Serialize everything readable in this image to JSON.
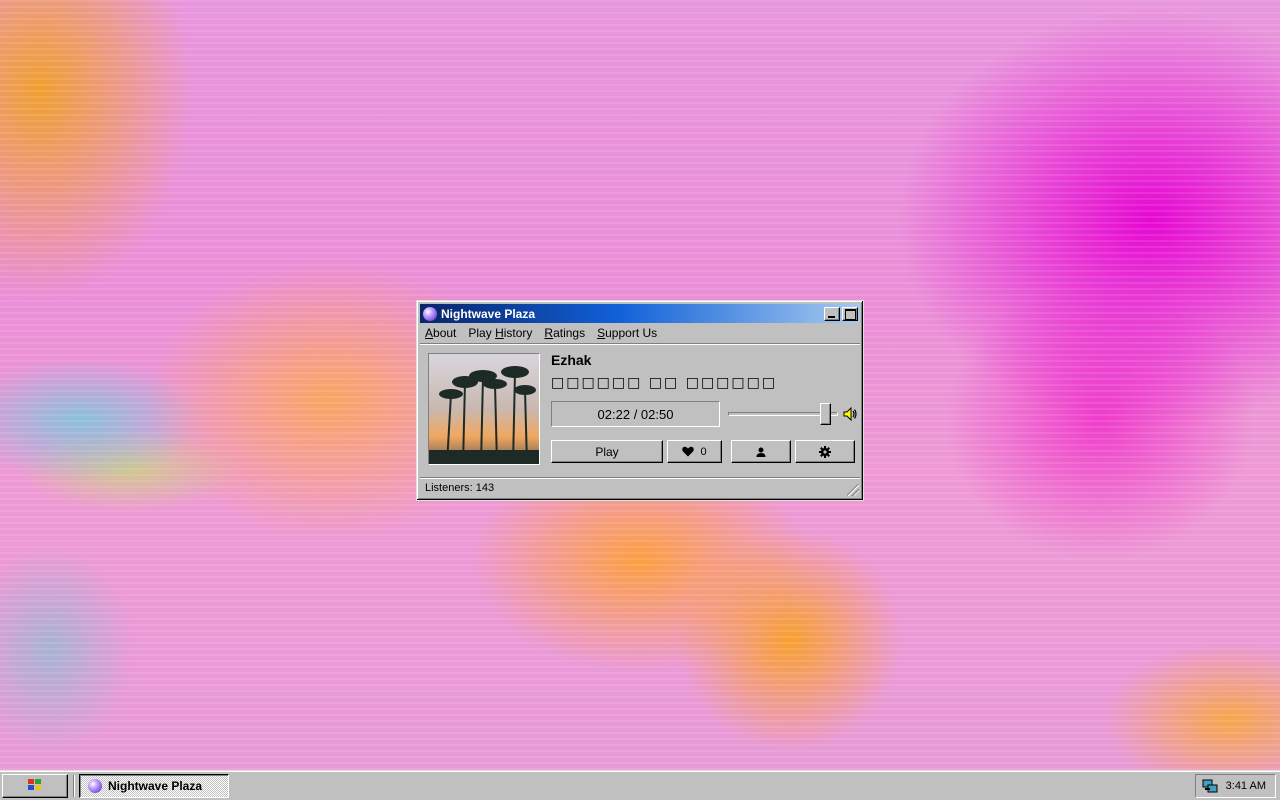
{
  "window": {
    "title": "Nightwave Plaza",
    "menu": [
      {
        "label": "About",
        "accel_index": 0
      },
      {
        "label": "Play History",
        "accel_index": 5
      },
      {
        "label": "Ratings",
        "accel_index": 0
      },
      {
        "label": "Support Us",
        "accel_index": 0
      }
    ]
  },
  "player": {
    "artist": "Ezhak",
    "song_title": "□□□□□□ □□ □□□□□□",
    "time": "02:22 / 02:50",
    "volume_fraction": 0.93,
    "play_label": "Play",
    "like_count": "0",
    "icons": {
      "like": "heart-icon",
      "user": "user-icon",
      "settings": "gear-icon",
      "volume": "speaker-icon"
    }
  },
  "status": {
    "listeners": "Listeners: 143"
  },
  "taskbar": {
    "task_label": "Nightwave Plaza",
    "clock": "3:41 AM"
  },
  "colors": {
    "titlebar_start": "#0a246a",
    "titlebar_end": "#a6caf0",
    "face": "#c0c0c0"
  }
}
